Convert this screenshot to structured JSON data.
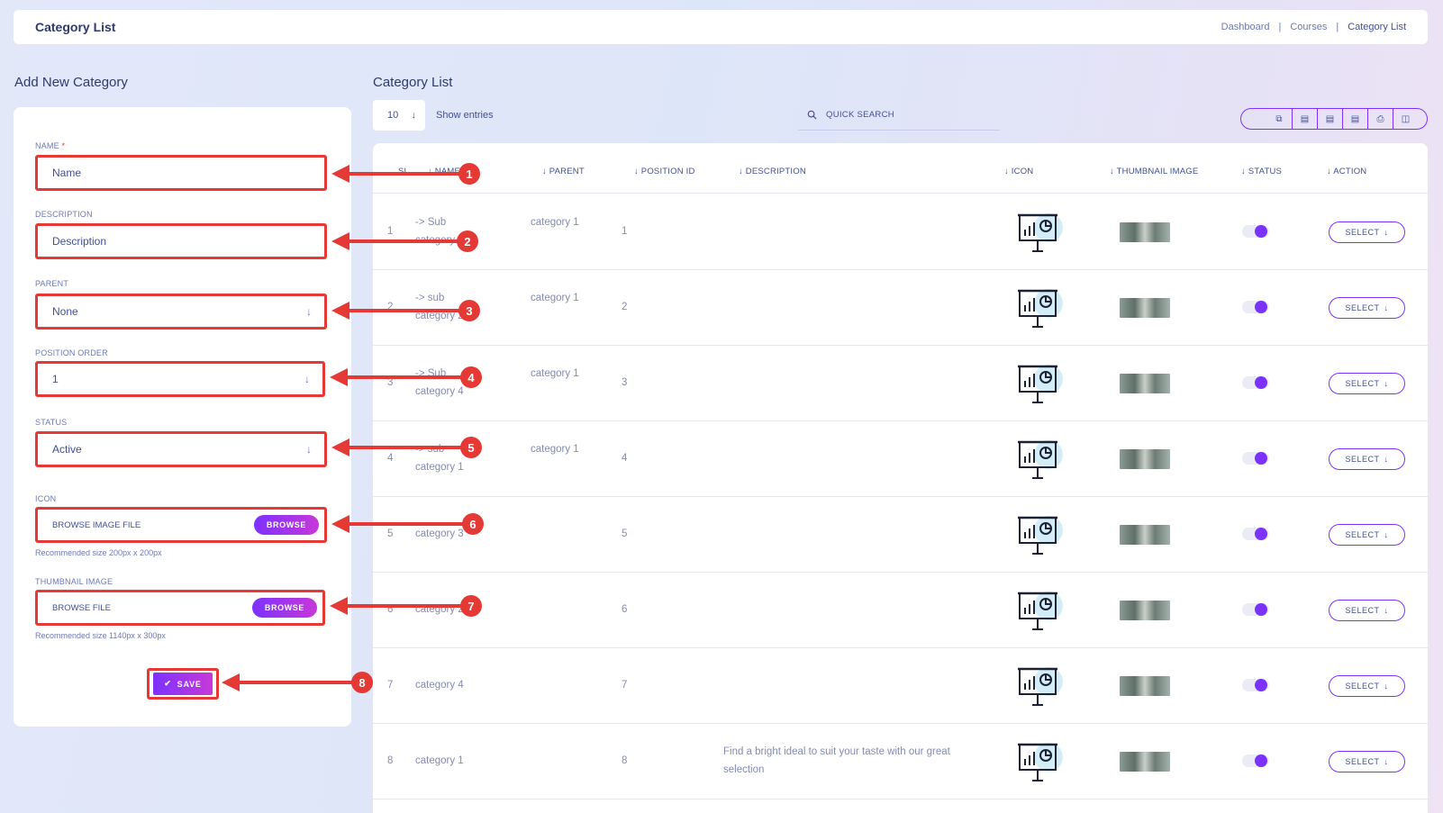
{
  "header": {
    "title": "Category List",
    "breadcrumbs": [
      "Dashboard",
      "Courses",
      "Category List"
    ]
  },
  "form": {
    "title": "Add New Category",
    "name_label": "NAME",
    "name_required": "*",
    "name_placeholder": "Name",
    "description_label": "DESCRIPTION",
    "description_placeholder": "Description",
    "parent_label": "PARENT",
    "parent_value": "None",
    "position_label": "POSITION ORDER",
    "position_value": "1",
    "status_label": "STATUS",
    "status_value": "Active",
    "icon_label": "ICON",
    "icon_placeholder": "BROWSE IMAGE FILE",
    "icon_browse": "BROWSE",
    "icon_hint": "Recommended size 200px x 200px",
    "thumb_label": "THUMBNAIL IMAGE",
    "thumb_placeholder": "BROWSE FILE",
    "thumb_browse": "BROWSE",
    "thumb_hint": "Recommended size 1140px x 300px",
    "save_label": "SAVE"
  },
  "list": {
    "title": "Category List",
    "entries_value": "10",
    "show_entries": "Show entries",
    "search_placeholder": "QUICK SEARCH",
    "columns": [
      "SL",
      "NAME",
      "PARENT",
      "POSITION ID",
      "DESCRIPTION",
      "ICON",
      "THUMBNAIL IMAGE",
      "STATUS",
      "ACTION"
    ],
    "rows": [
      {
        "sl": "1",
        "name": "-> Sub category",
        "parent": "category 1",
        "position": "1",
        "description": "",
        "select": "SELECT"
      },
      {
        "sl": "2",
        "name": "-> sub category 2",
        "parent": "category 1",
        "position": "2",
        "description": "",
        "select": "SELECT"
      },
      {
        "sl": "3",
        "name": "-> Sub category 4",
        "parent": "category 1",
        "position": "3",
        "description": "",
        "select": "SELECT"
      },
      {
        "sl": "4",
        "name": "-> sub category 1",
        "parent": "category 1",
        "position": "4",
        "description": "",
        "select": "SELECT"
      },
      {
        "sl": "5",
        "name": "category 3",
        "parent": "",
        "position": "5",
        "description": "",
        "select": "SELECT"
      },
      {
        "sl": "6",
        "name": "category 2",
        "parent": "",
        "position": "6",
        "description": "",
        "select": "SELECT"
      },
      {
        "sl": "7",
        "name": "category 4",
        "parent": "",
        "position": "7",
        "description": "",
        "select": "SELECT"
      },
      {
        "sl": "8",
        "name": "category 1",
        "parent": "",
        "position": "8",
        "description": "Find a bright ideal to suit your taste with our great selection",
        "select": "SELECT"
      }
    ]
  },
  "annotations": [
    "1",
    "2",
    "3",
    "4",
    "5",
    "6",
    "7",
    "8"
  ],
  "colors": {
    "accent": "#7c32ff",
    "annotation": "#e53935",
    "text": "#415094"
  }
}
